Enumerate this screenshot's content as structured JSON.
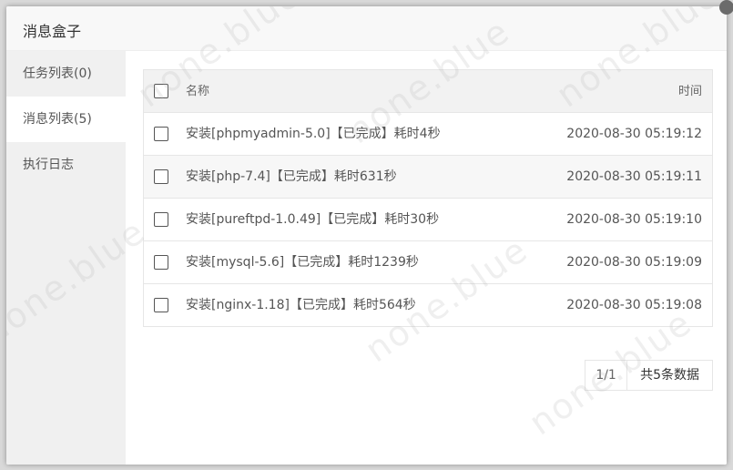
{
  "dialog": {
    "title": "消息盒子"
  },
  "sidebar": {
    "items": [
      {
        "label": "任务列表(0)"
      },
      {
        "label": "消息列表(5)"
      },
      {
        "label": "执行日志"
      }
    ],
    "active_index": 1
  },
  "table": {
    "columns": {
      "name": "名称",
      "time": "时间"
    },
    "rows": [
      {
        "name": "安装[phpmyadmin-5.0]【已完成】耗时4秒",
        "time": "2020-08-30 05:19:12"
      },
      {
        "name": "安装[php-7.4]【已完成】耗时631秒",
        "time": "2020-08-30 05:19:11"
      },
      {
        "name": "安装[pureftpd-1.0.49]【已完成】耗时30秒",
        "time": "2020-08-30 05:19:10"
      },
      {
        "name": "安装[mysql-5.6]【已完成】耗时1239秒",
        "time": "2020-08-30 05:19:09"
      },
      {
        "name": "安装[nginx-1.18]【已完成】耗时564秒",
        "time": "2020-08-30 05:19:08"
      }
    ]
  },
  "pagination": {
    "page": "1/1",
    "count": "共5条数据"
  },
  "watermark": {
    "text": "none.blue"
  },
  "colors": {
    "sidebar_bg": "#f0f0f0",
    "header_bg": "#f8f8f8",
    "border": "#e6e6e6"
  }
}
